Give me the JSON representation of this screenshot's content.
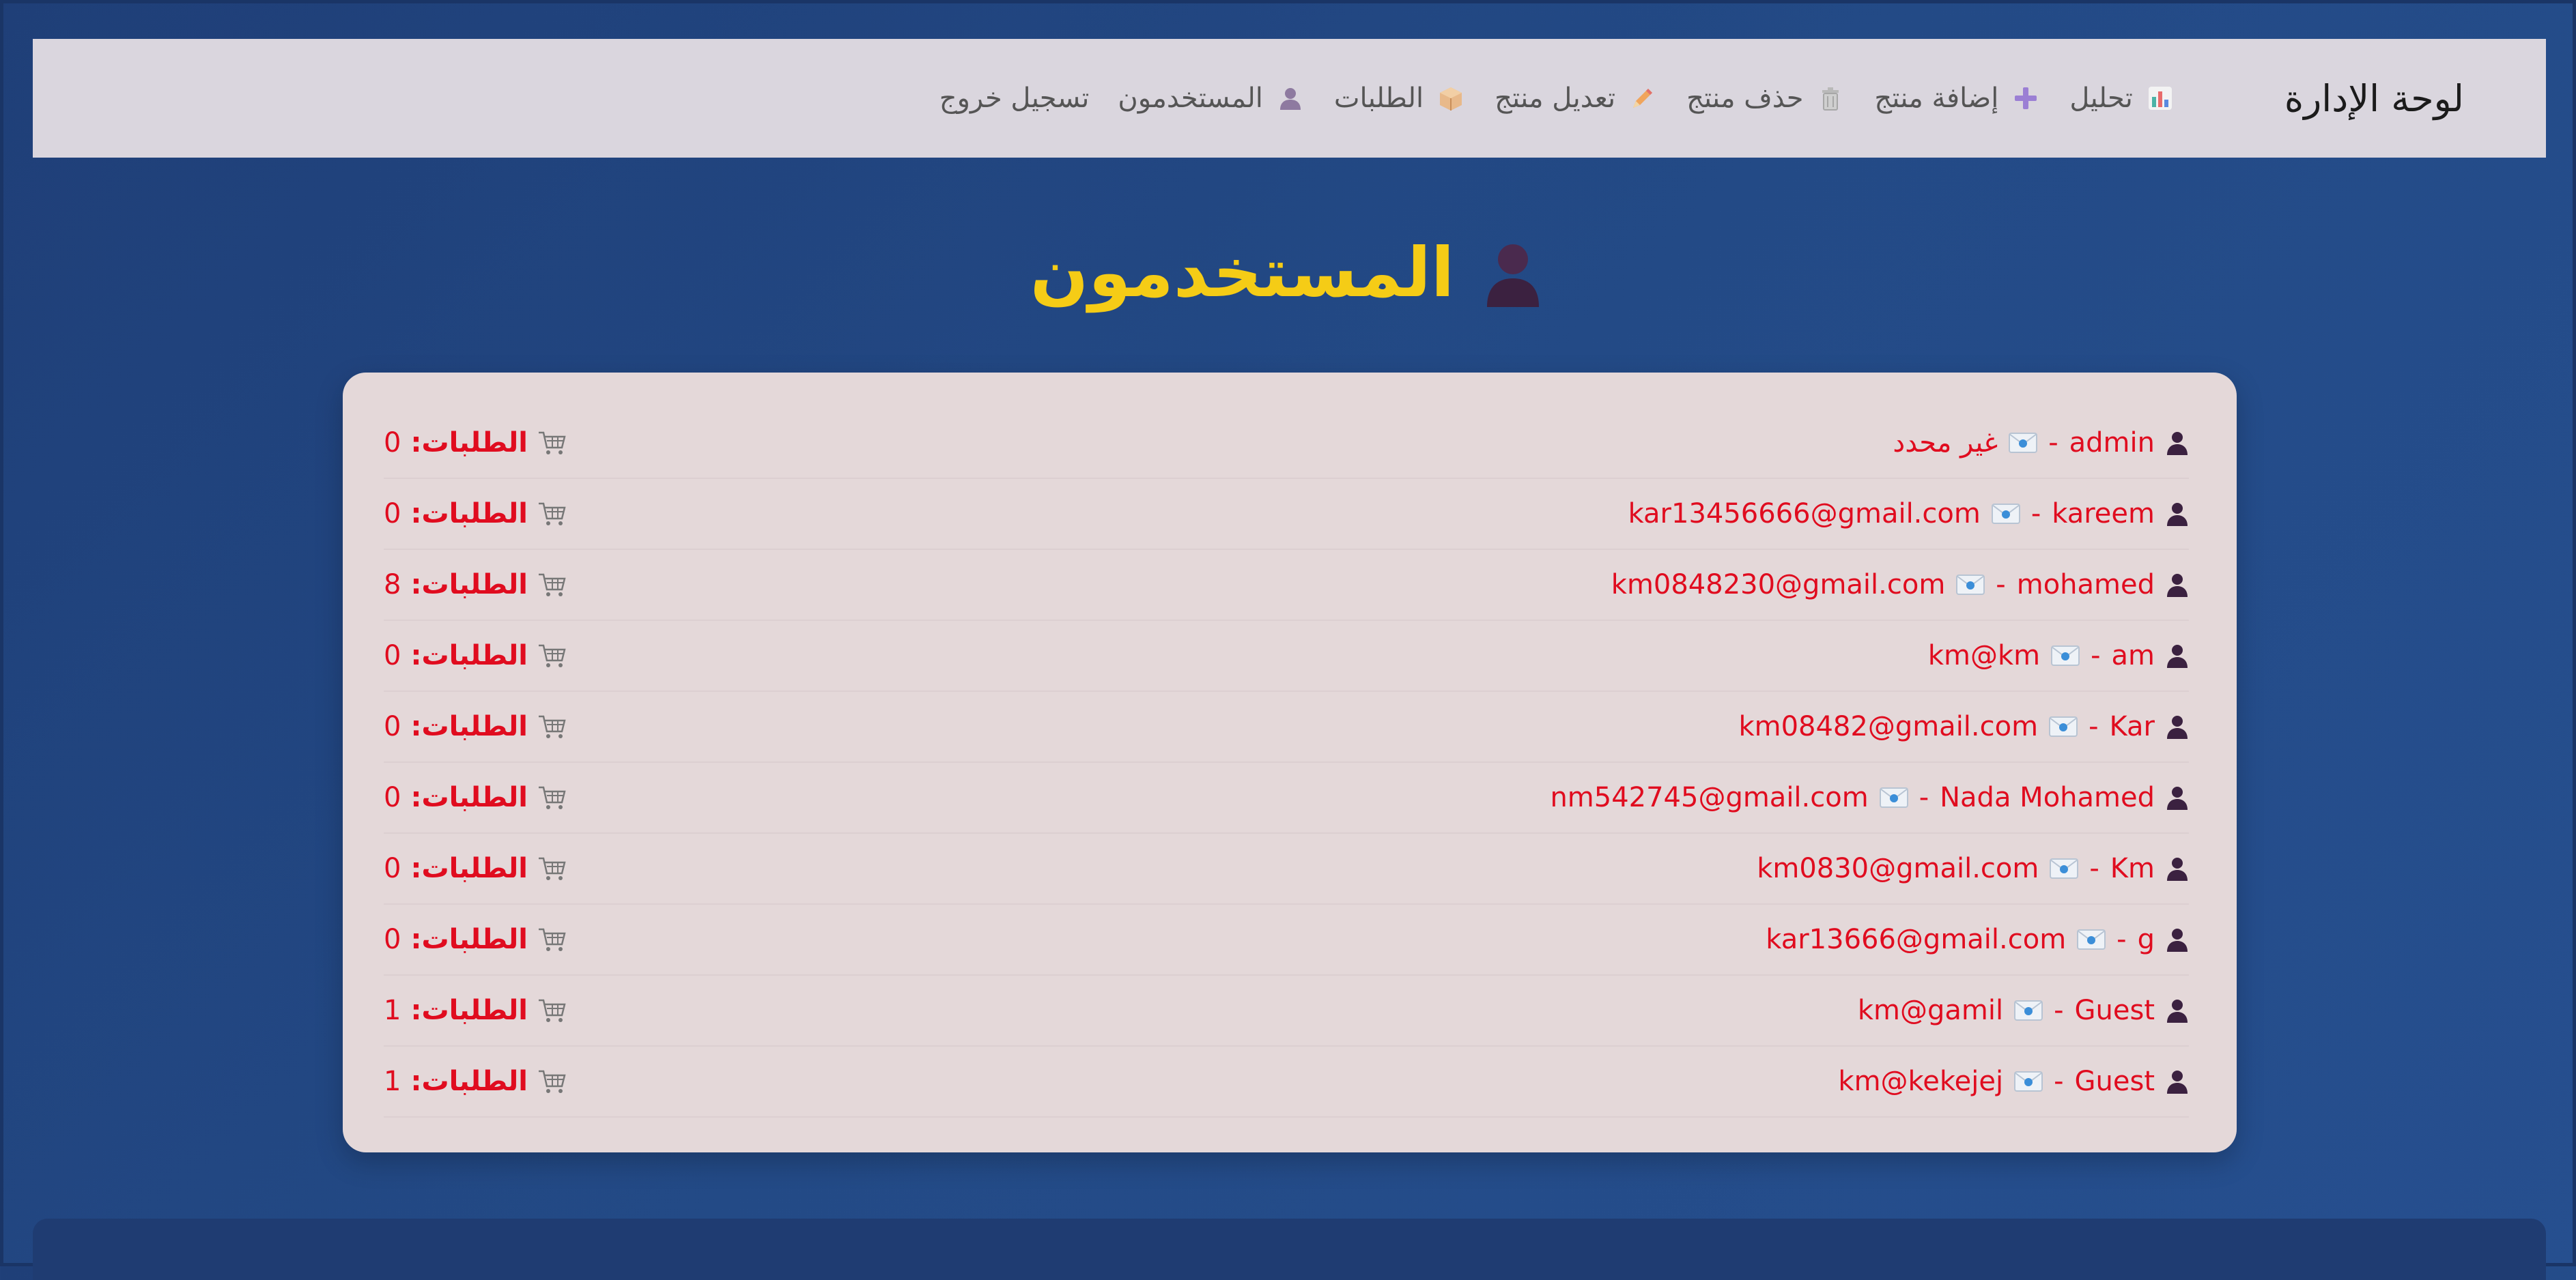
{
  "navbar": {
    "brand": "لوحة الإدارة",
    "links": [
      {
        "label": "تحليل",
        "icon": "bar-chart-icon"
      },
      {
        "label": "إضافة منتج",
        "icon": "plus-icon"
      },
      {
        "label": "حذف منتج",
        "icon": "trash-icon"
      },
      {
        "label": "تعديل منتج",
        "icon": "pencil-icon"
      },
      {
        "label": "الطلبات",
        "icon": "package-icon"
      },
      {
        "label": "المستخدمون",
        "icon": "user-icon"
      },
      {
        "label": "تسجيل خروج",
        "icon": ""
      }
    ]
  },
  "page": {
    "title": "المستخدمون",
    "title_icon": "user-silhouette-icon"
  },
  "users": {
    "orders_label": "الطلبات:",
    "rows": [
      {
        "name": "admin",
        "email": "غير محدد",
        "orders": "0"
      },
      {
        "name": "kareem",
        "email": "kar13456666@gmail.com",
        "orders": "0"
      },
      {
        "name": "mohamed",
        "email": "km0848230@gmail.com",
        "orders": "8"
      },
      {
        "name": "am",
        "email": "km@km",
        "orders": "0"
      },
      {
        "name": "Kar",
        "email": "km08482@gmail.com",
        "orders": "0"
      },
      {
        "name": "Nada Mohamed",
        "email": "nm542745@gmail.com",
        "orders": "0"
      },
      {
        "name": "Km",
        "email": "km0830@gmail.com",
        "orders": "0"
      },
      {
        "name": "g",
        "email": "kar13666@gmail.com",
        "orders": "0"
      },
      {
        "name": "Guest",
        "email": "km@gamil",
        "orders": "1"
      },
      {
        "name": "Guest",
        "email": "km@kekejej",
        "orders": "1"
      }
    ],
    "separator": "-"
  },
  "colors": {
    "background": "#234a86",
    "navbar": "#dad6de",
    "title": "#f5cc16",
    "card": "#e4d8d9",
    "row_text": "#e00c1f"
  }
}
